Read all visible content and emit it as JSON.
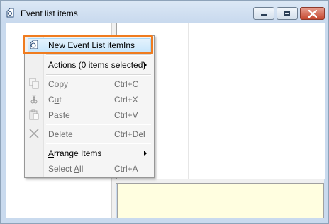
{
  "window": {
    "title": "Event list items",
    "icon": "event-list-icon"
  },
  "title_buttons": {
    "minimize_icon": "minimize-icon",
    "maximize_icon": "maximize-icon",
    "close_icon": "close-icon"
  },
  "context_menu": {
    "items": [
      {
        "label": "New Event List item",
        "shortcut": "Ins",
        "enabled": true,
        "icon": "new-event-icon",
        "highlighted": true
      },
      {
        "label": "Actions (0 items selected)",
        "shortcut": "",
        "enabled": true,
        "submenu": true
      },
      {
        "label_pre": "",
        "label_u": "C",
        "label_post": "opy",
        "shortcut": "Ctrl+C",
        "enabled": false,
        "icon": "copy-icon"
      },
      {
        "label_pre": "C",
        "label_u": "u",
        "label_post": "t",
        "shortcut": "Ctrl+X",
        "enabled": false,
        "icon": "cut-icon"
      },
      {
        "label_pre": "",
        "label_u": "P",
        "label_post": "aste",
        "shortcut": "Ctrl+V",
        "enabled": false,
        "icon": "paste-icon"
      },
      {
        "label_pre": "",
        "label_u": "D",
        "label_post": "elete",
        "shortcut": "Ctrl+Del",
        "enabled": false,
        "icon": "delete-icon"
      },
      {
        "label_pre": "",
        "label_u": "A",
        "label_post": "rrange Items",
        "shortcut": "",
        "enabled": true,
        "submenu": true
      },
      {
        "label_pre": "Select ",
        "label_u": "A",
        "label_post": "ll",
        "shortcut": "Ctrl+A",
        "enabled": false
      }
    ]
  },
  "colors": {
    "highlight_border": "#f07c1f",
    "detail_pane_bg": "#fffee0",
    "titlebar_bg": "#c9daee"
  }
}
